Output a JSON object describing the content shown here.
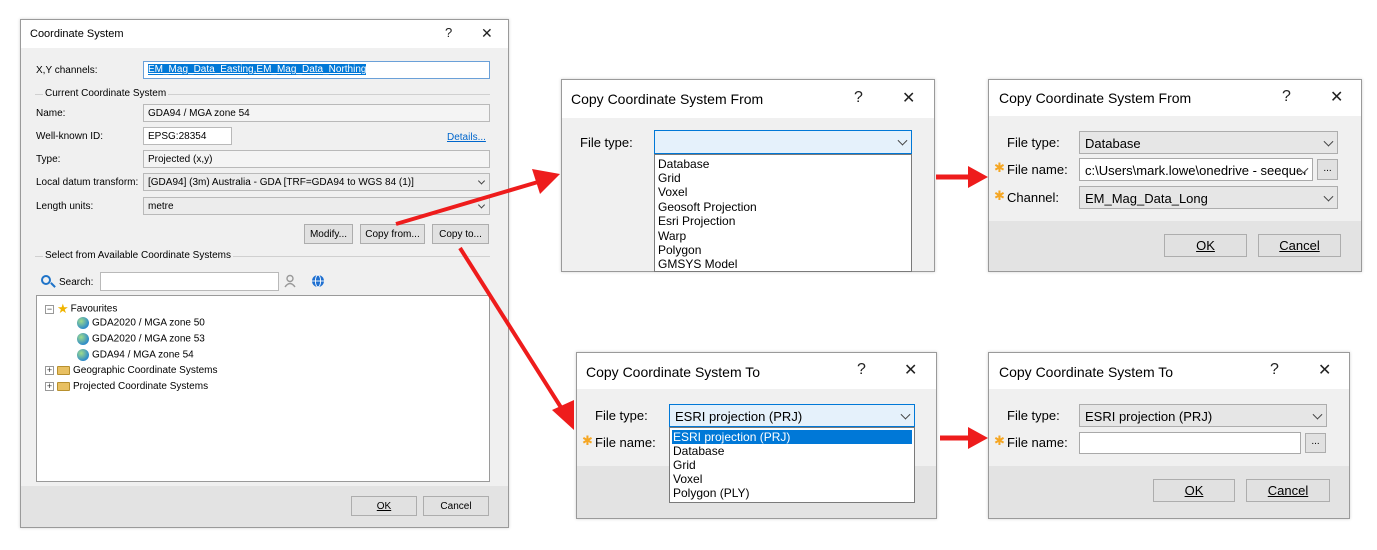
{
  "colors": {
    "arrow": "#ee1c1c",
    "selection": "#0078d7",
    "dialog_bg": "#f0f0f0"
  },
  "main_dialog": {
    "title": "Coordinate System",
    "help": "?",
    "close": "✕",
    "xy_label": "X,Y channels:",
    "xy_value": "EM_Mag_Data_Easting,EM_Mag_Data_Northing",
    "current_group": "Current Coordinate System",
    "name_label": "Name:",
    "name_value": "GDA94 / MGA zone 54",
    "wkid_label": "Well-known ID:",
    "wkid_value": "EPSG:28354",
    "details_link": "Details...",
    "type_label": "Type:",
    "type_value": "Projected (x,y)",
    "datum_label": "Local datum transform:",
    "datum_value": "[GDA94] (3m) Australia - GDA [TRF=GDA94 to WGS 84 (1)]",
    "length_label": "Length units:",
    "length_value": "metre",
    "modify_btn": "Modify...",
    "copy_from_btn": "Copy from...",
    "copy_to_btn": "Copy to...",
    "select_group": "Select from Available Coordinate Systems",
    "search_label": "Search:",
    "search_value": "",
    "tree": {
      "favourites": "Favourites",
      "fav_items": [
        "GDA2020 / MGA zone 50",
        "GDA2020 / MGA zone 53",
        "GDA94 / MGA zone 54"
      ],
      "geographic": "Geographic Coordinate Systems",
      "projected": "Projected Coordinate Systems"
    },
    "ok": "OK",
    "cancel": "Cancel"
  },
  "copy_from_1": {
    "title": "Copy Coordinate System From",
    "help": "?",
    "close": "✕",
    "file_type_label": "File type:",
    "file_type_value": "",
    "options": [
      "Database",
      "Grid",
      "Voxel",
      "Geosoft Projection",
      "Esri Projection",
      "Warp",
      "Polygon",
      "GMSYS Model"
    ]
  },
  "copy_from_2": {
    "title": "Copy Coordinate System From",
    "help": "?",
    "close": "✕",
    "file_type_label": "File type:",
    "file_type_value": "Database",
    "file_name_label": "File name:",
    "file_name_value": "c:\\Users\\mark.lowe\\onedrive - seequer",
    "channel_label": "Channel:",
    "channel_value": "EM_Mag_Data_Long",
    "browse": "...",
    "ok": "OK",
    "cancel": "Cancel"
  },
  "copy_to_1": {
    "title": "Copy Coordinate System To",
    "help": "?",
    "close": "✕",
    "file_type_label": "File type:",
    "file_type_value": "ESRI projection (PRJ)",
    "file_name_label": "File name:",
    "options": [
      "ESRI projection (PRJ)",
      "Database",
      "Grid",
      "Voxel",
      "Polygon (PLY)"
    ]
  },
  "copy_to_2": {
    "title": "Copy Coordinate System To",
    "help": "?",
    "close": "✕",
    "file_type_label": "File type:",
    "file_type_value": "ESRI projection (PRJ)",
    "file_name_label": "File name:",
    "file_name_value": "",
    "browse": "...",
    "ok": "OK",
    "cancel": "Cancel"
  }
}
